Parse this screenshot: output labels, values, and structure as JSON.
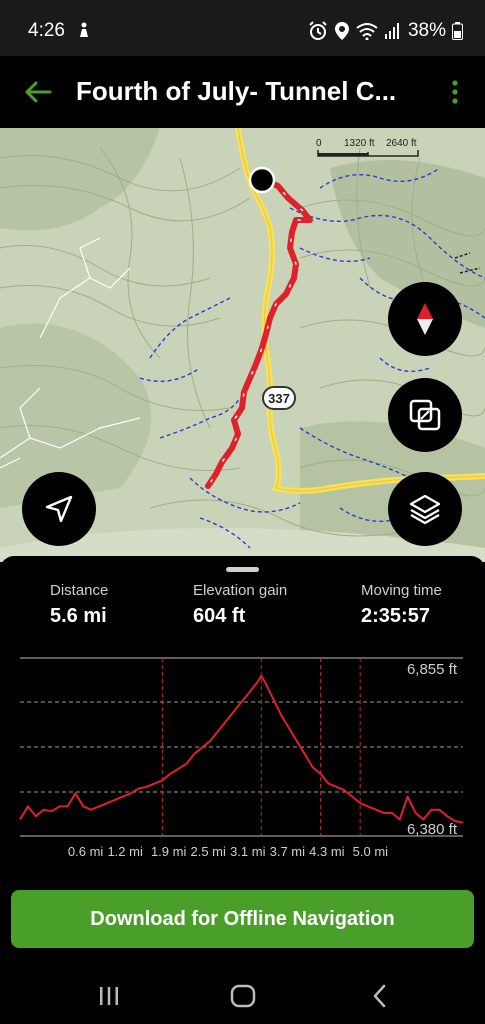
{
  "status_bar": {
    "time": "4:26",
    "battery": "38%"
  },
  "header": {
    "title": "Fourth of July- Tunnel C...",
    "accent_color": "#4a9e2a"
  },
  "map": {
    "scale_labels": [
      "0",
      "1320 ft",
      "2640 ft"
    ],
    "route_number": "337",
    "buttons": [
      "compass-icon",
      "copy-icon",
      "layers-icon",
      "locate-icon"
    ]
  },
  "stats": {
    "distance": {
      "label": "Distance",
      "value": "5.6 mi"
    },
    "elevation_gain": {
      "label": "Elevation gain",
      "value": "604 ft"
    },
    "moving_time": {
      "label": "Moving time",
      "value": "2:35:57"
    }
  },
  "chart_data": {
    "type": "line",
    "title": "",
    "xlabel": "",
    "ylabel": "",
    "x_ticks": [
      "0.6 mi",
      "1.2 mi",
      "1.9 mi",
      "2.5 mi",
      "3.1 mi",
      "3.7 mi",
      "4.3 mi",
      "5.0 mi"
    ],
    "y_labels": [
      "6,855 ft",
      "6,380 ft"
    ],
    "ylim": [
      6380,
      6855
    ],
    "xlim": [
      0,
      5.6
    ],
    "series": [
      {
        "color": "#e0202a",
        "x": [
          0.0,
          0.1,
          0.2,
          0.3,
          0.4,
          0.5,
          0.6,
          0.7,
          0.8,
          0.9,
          1.0,
          1.1,
          1.2,
          1.3,
          1.4,
          1.5,
          1.6,
          1.7,
          1.8,
          1.9,
          2.0,
          2.1,
          2.2,
          2.3,
          2.4,
          2.5,
          2.6,
          2.7,
          2.8,
          2.9,
          3.0,
          3.05,
          3.1,
          3.2,
          3.3,
          3.4,
          3.5,
          3.6,
          3.7,
          3.8,
          3.9,
          4.0,
          4.1,
          4.2,
          4.3,
          4.4,
          4.5,
          4.6,
          4.7,
          4.8,
          4.9,
          5.0,
          5.1,
          5.2,
          5.3,
          5.4,
          5.5,
          5.6
        ],
        "values": [
          6400,
          6440,
          6410,
          6430,
          6425,
          6440,
          6440,
          6480,
          6440,
          6430,
          6440,
          6450,
          6460,
          6470,
          6480,
          6495,
          6500,
          6510,
          6520,
          6540,
          6555,
          6570,
          6600,
          6620,
          6640,
          6670,
          6700,
          6730,
          6760,
          6790,
          6820,
          6840,
          6820,
          6770,
          6720,
          6680,
          6640,
          6600,
          6560,
          6540,
          6510,
          6500,
          6490,
          6470,
          6450,
          6440,
          6430,
          6420,
          6420,
          6400,
          6470,
          6420,
          6400,
          6430,
          6430,
          6410,
          6395,
          6390
        ]
      }
    ]
  },
  "download": {
    "label": "Download for Offline Navigation"
  },
  "nav_bar": [
    "recent-apps-icon",
    "home-icon",
    "back-icon"
  ]
}
